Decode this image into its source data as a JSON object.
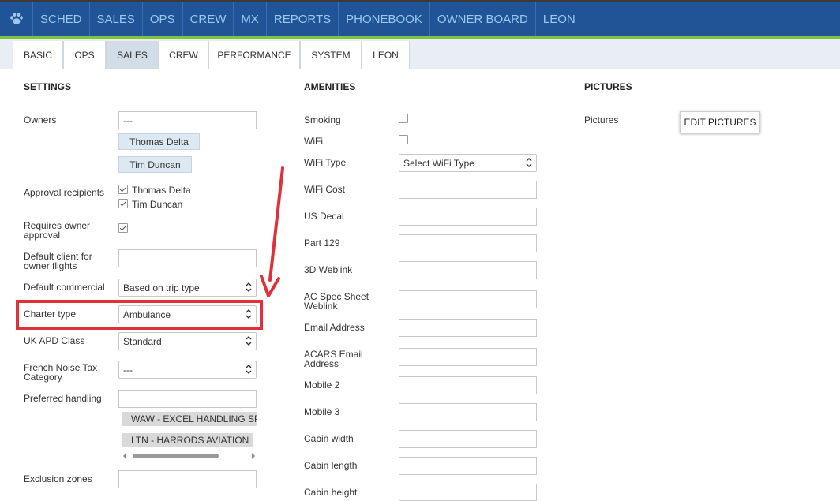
{
  "topnav": {
    "items": [
      "SCHED",
      "SALES",
      "OPS",
      "CREW",
      "MX",
      "REPORTS",
      "PHONEBOOK",
      "OWNER BOARD",
      "LEON"
    ]
  },
  "subnav": {
    "tabs": [
      "BASIC",
      "OPS",
      "SALES",
      "CREW",
      "PERFORMANCE",
      "SYSTEM",
      "LEON"
    ],
    "active": "SALES"
  },
  "settings": {
    "heading": "SETTINGS",
    "owners_label": "Owners",
    "owners_value": "---",
    "owner_chips": [
      "Thomas Delta",
      "Tim Duncan"
    ],
    "approval_label": "Approval recipients",
    "approval_items": [
      "Thomas Delta",
      "Tim Duncan"
    ],
    "requires_label_1": "Requires owner",
    "requires_label_2": "approval",
    "default_client_label_1": "Default client for",
    "default_client_label_2": "owner flights",
    "default_commercial_label": "Default commercial",
    "default_commercial_value": "Based on trip type",
    "charter_type_label": "Charter type",
    "charter_type_value": "Ambulance",
    "uk_apd_label": "UK APD Class",
    "uk_apd_value": "Standard",
    "french_noise_label_1": "French Noise Tax",
    "french_noise_label_2": "Category",
    "french_noise_value": "---",
    "preferred_handling_label": "Preferred handling",
    "handling_chips": [
      "WAW - EXCEL HANDLING SP.",
      "LTN - HARRODS AVIATION"
    ],
    "exclusion_label": "Exclusion zones"
  },
  "amenities": {
    "heading": "AMENITIES",
    "smoking_label": "Smoking",
    "wifi_label": "WiFi",
    "wifi_type_label": "WiFi Type",
    "wifi_type_value": "Select WiFi Type",
    "wifi_cost_label": "WiFi Cost",
    "us_decal_label": "US Decal",
    "part129_label": "Part 129",
    "weblink3d_label": "3D Weblink",
    "ac_spec_label_1": "AC Spec Sheet",
    "ac_spec_label_2": "Weblink",
    "email_label": "Email Address",
    "acars_label_1": "ACARS Email",
    "acars_label_2": "Address",
    "mobile2_label": "Mobile 2",
    "mobile3_label": "Mobile 3",
    "cabin_width_label": "Cabin width",
    "cabin_length_label": "Cabin length",
    "cabin_height_label": "Cabin height"
  },
  "pictures": {
    "heading": "PICTURES",
    "label": "Pictures",
    "edit_button": "EDIT PICTURES"
  },
  "colors": {
    "nav_bg": "#1f5596",
    "nav_text": "#9cc7ee",
    "accent_green": "#7ec242",
    "highlight_red": "#e0303a"
  }
}
